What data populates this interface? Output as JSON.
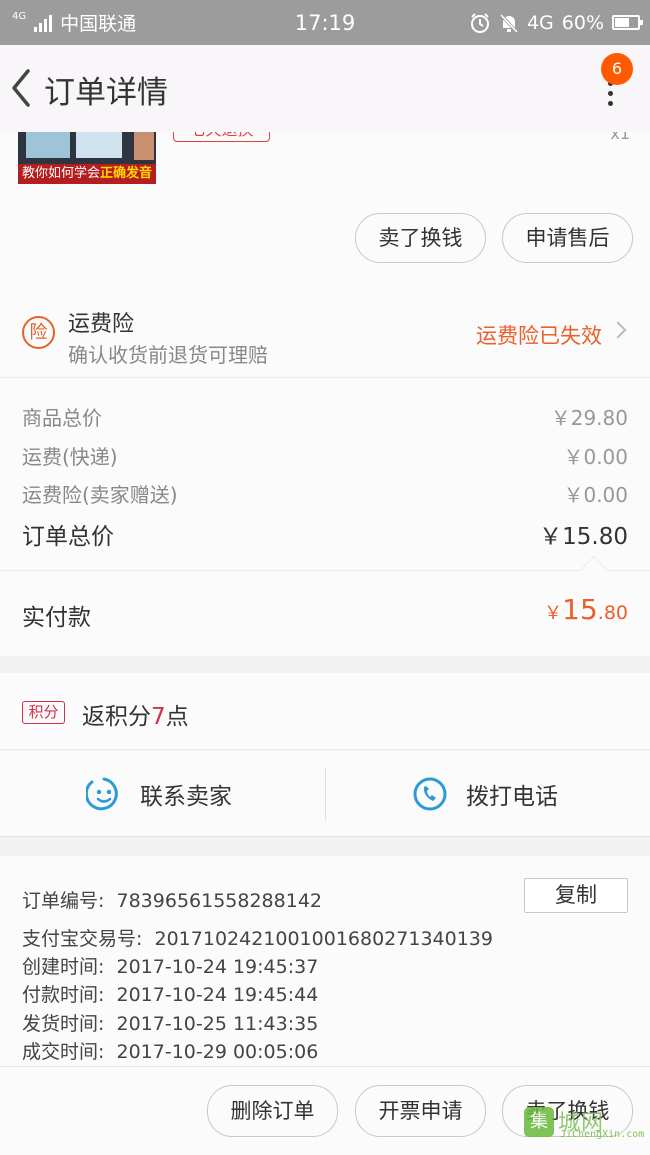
{
  "status_bar": {
    "network_label": "4G",
    "carrier": "中国联通",
    "time": "17:19",
    "network_right": "4G",
    "battery": "60%"
  },
  "nav": {
    "title": "订单详情",
    "badge_count": "6"
  },
  "product": {
    "thumb_caption_a": "教你如何学会",
    "thumb_caption_b": "正确发音",
    "tag_text": "七天退换",
    "qty": "x1",
    "buttons": [
      "卖了换钱",
      "申请售后"
    ]
  },
  "insurance": {
    "icon_text": "险",
    "title": "运费险",
    "subtitle": "确认收货前退货可理赔",
    "status": "运费险已失效",
    "status_color": "#e8602a"
  },
  "prices": {
    "rows": [
      {
        "label": "商品总价",
        "value": "￥29.80"
      },
      {
        "label": "运费(快递)",
        "value": "￥0.00"
      },
      {
        "label": "运费险(卖家赠送)",
        "value": "￥0.00"
      }
    ],
    "total_label": "订单总价",
    "total_value": "￥15.80",
    "paid_label": "实付款",
    "paid_currency": "￥",
    "paid_integer": "15",
    "paid_decimal": ".80"
  },
  "points": {
    "badge": "积分",
    "text_prefix": "返积分",
    "amount": "7",
    "text_suffix": "点"
  },
  "contact": {
    "seller_label": "联系卖家",
    "phone_label": "拨打电话"
  },
  "order_info": {
    "rows": [
      {
        "key": "订单编号:",
        "value": "78396561558288142"
      },
      {
        "key": "支付宝交易号:",
        "value": "2017102421001001680271340139"
      },
      {
        "key": "创建时间:",
        "value": "2017-10-24 19:45:37"
      },
      {
        "key": "付款时间:",
        "value": "2017-10-24 19:45:44"
      },
      {
        "key": "发货时间:",
        "value": "2017-10-25 11:43:35"
      },
      {
        "key": "成交时间:",
        "value": "2017-10-29 00:05:06"
      }
    ],
    "copy_label": "复制"
  },
  "bottom_bar": {
    "buttons": [
      "删除订单",
      "开票申请",
      "卖了换钱"
    ]
  },
  "watermark": {
    "mark": "集",
    "text": "城网",
    "url": "JiChengXin.com"
  },
  "colors": {
    "accent_orange": "#e8602a",
    "badge_orange": "#ff5a00",
    "points_red": "#d0304a",
    "status_bar_gray": "#9c9c9c"
  }
}
